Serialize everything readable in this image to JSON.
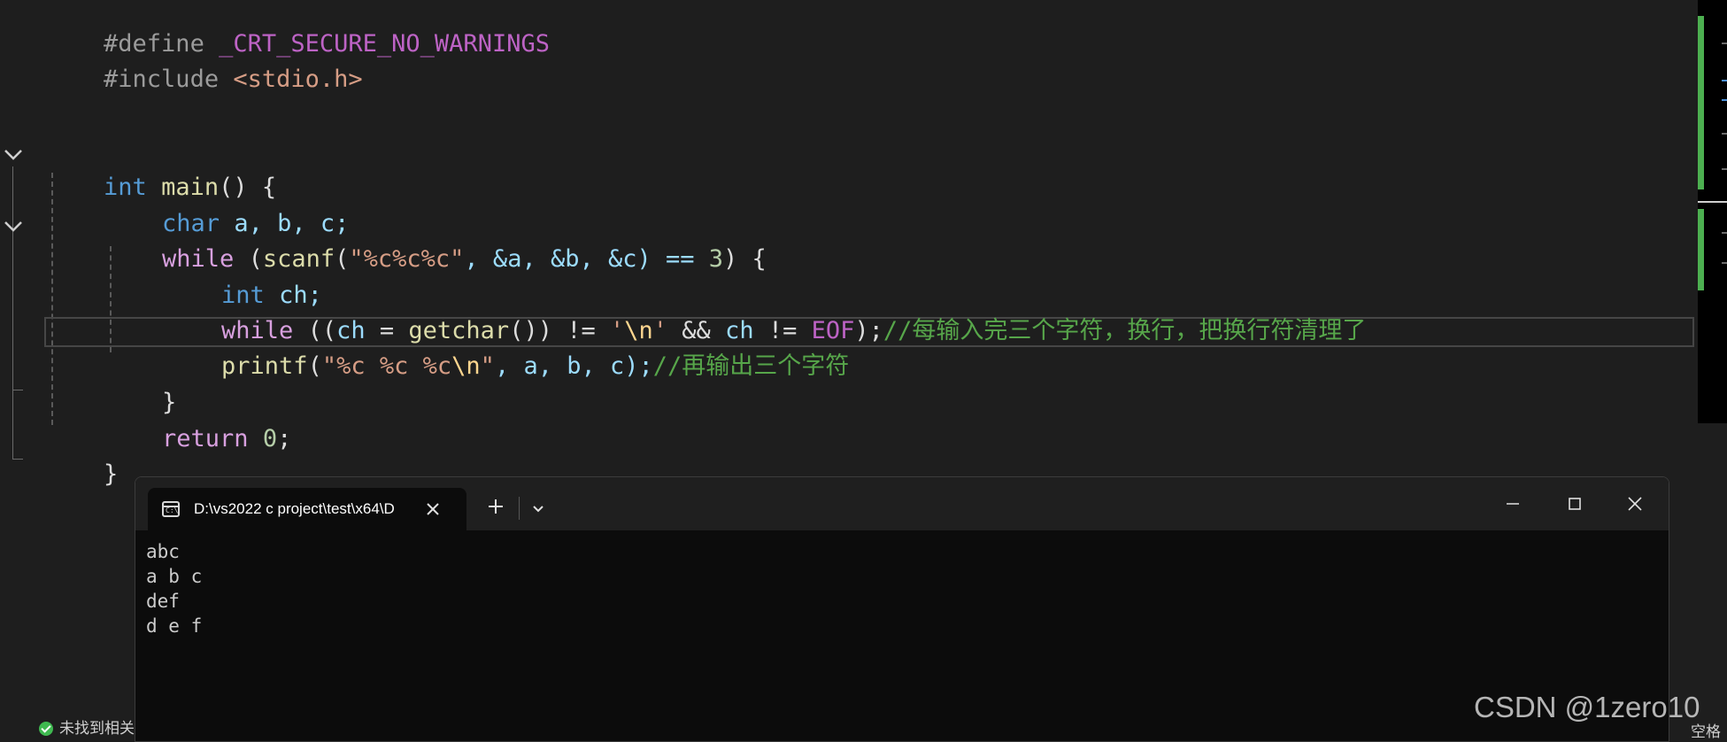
{
  "editor": {
    "lines": {
      "define_kw": "#define",
      "define_macro": "_CRT_SECURE_NO_WARNINGS",
      "include_kw": "#include",
      "include_file": "<stdio.h>",
      "main_type": "int",
      "main_name": "main",
      "main_rest": "() {",
      "char_kw": "char",
      "char_vars": " a, b, c;",
      "while1_kw": "while",
      "while1_open": " (",
      "scanf_fn": "scanf",
      "scanf_paren": "(",
      "scanf_str": "\"%c%c%c\"",
      "scanf_args": ", &a, &b, &c) == ",
      "scanf_num": "3",
      "scanf_close": ") {",
      "int_kw": "int",
      "ch_decl": " ch;",
      "while2_kw": "while",
      "while2_open": " ((",
      "ch_var": "ch",
      "eq": " = ",
      "getchar_fn": "getchar",
      "while2_mid": "()) != ",
      "q1": "'",
      "nl_esc": "\\n",
      "q2": "'",
      "and": " && ",
      "ch_var2": "ch",
      "neq": " != ",
      "eof_macro": "EOF",
      "while2_end": ");",
      "comment1": "//每输入完三个字符，换行，把换行符清理了",
      "printf_fn": "printf",
      "printf_paren": "(",
      "printf_str1": "\"%c %c %c",
      "printf_esc": "\\n",
      "printf_str2": "\"",
      "printf_args": ", a, b, c);",
      "comment2": "//再输出三个字符",
      "close_brace_inner": "}",
      "return_kw": "return",
      "return_num": " 0",
      "return_semi": ";",
      "close_brace_main": "}"
    }
  },
  "terminal": {
    "tab_title": "D:\\vs2022 c project\\test\\x64\\D",
    "icon_glyph": "C:\\",
    "output": [
      "abc",
      "a b c",
      "def",
      "d e f"
    ]
  },
  "status_bar": {
    "left_text": "未找到相关",
    "right_text": "空格"
  },
  "watermark": "CSDN @1zero10",
  "colors": {
    "editor_bg": "#1e1e1e",
    "keyword": "#569cd6",
    "control": "#d8a0df",
    "function": "#dcdcaa",
    "string": "#d69d85",
    "comment": "#57a64a",
    "terminal_bg": "#0c0c0c",
    "scroll_marker": "#4caf50"
  }
}
